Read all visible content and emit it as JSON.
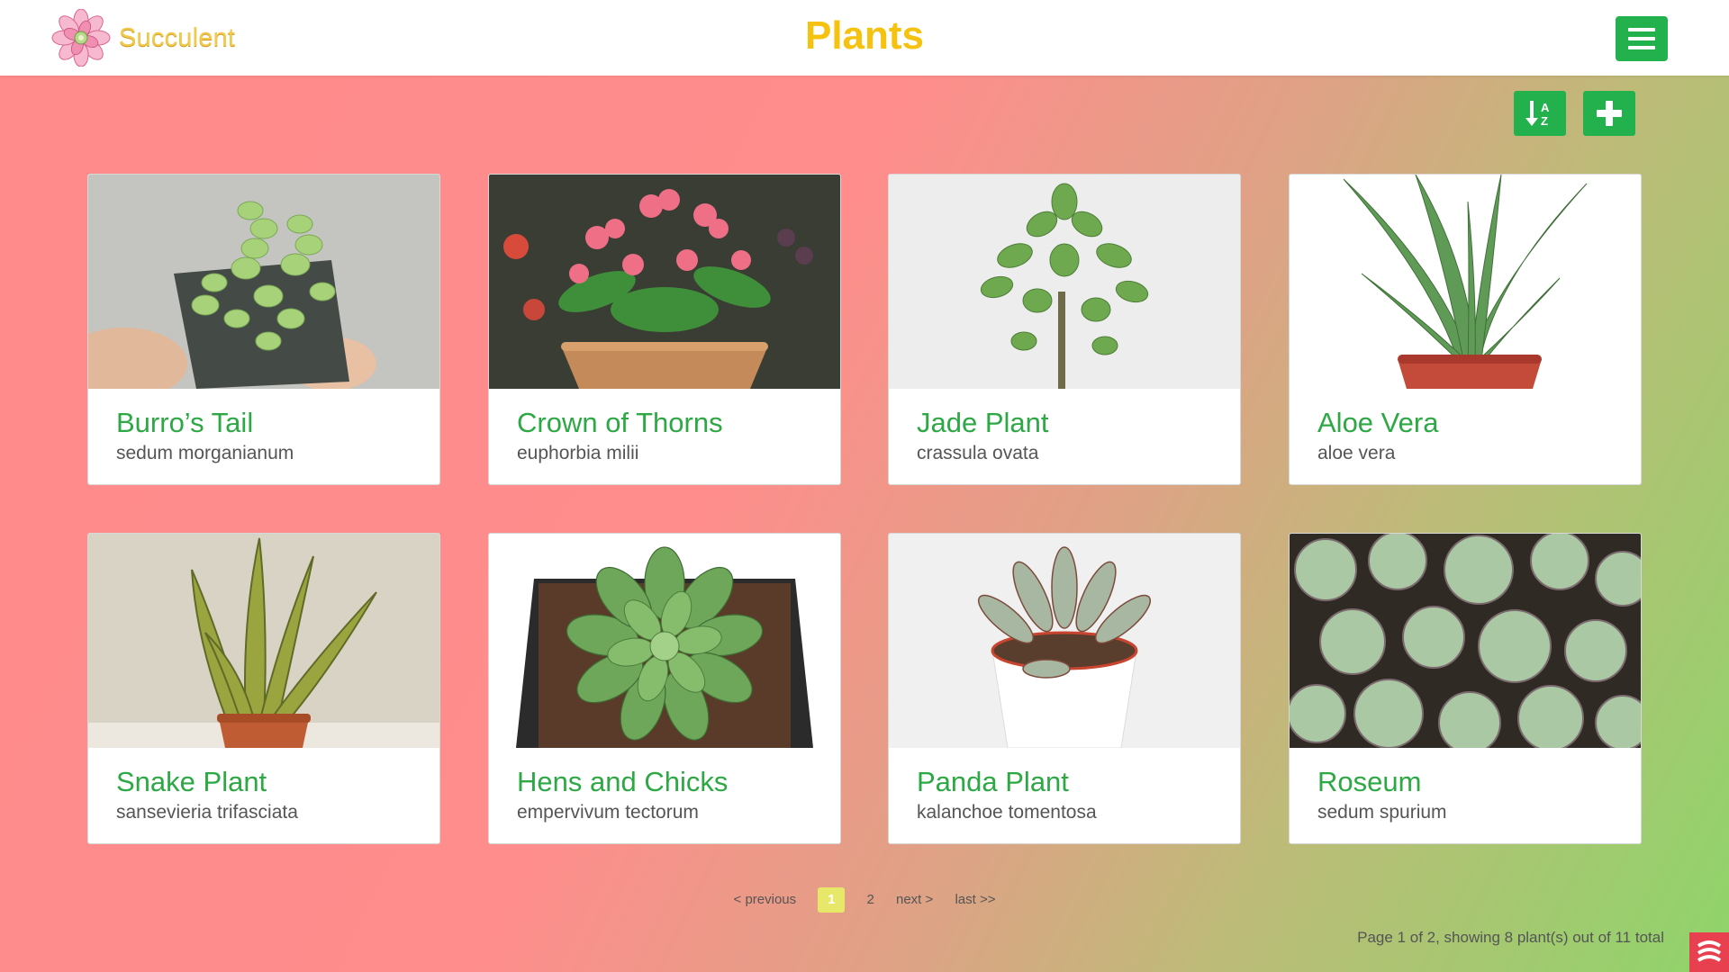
{
  "header": {
    "brand_name": "Succulent",
    "title": "Plants"
  },
  "toolbar": {
    "sort_icon": "sort-alpha-icon",
    "add_icon": "plus-icon",
    "menu_icon": "hamburger-icon"
  },
  "plants": [
    {
      "name": "Burro’s Tail",
      "scientific": "sedum morganianum"
    },
    {
      "name": "Crown of Thorns",
      "scientific": "euphorbia milii"
    },
    {
      "name": "Jade Plant",
      "scientific": "crassula ovata"
    },
    {
      "name": "Aloe Vera",
      "scientific": "aloe vera"
    },
    {
      "name": "Snake Plant",
      "scientific": "sansevieria trifasciata"
    },
    {
      "name": "Hens and Chicks",
      "scientific": "empervivum tectorum"
    },
    {
      "name": "Panda Plant",
      "scientific": "kalanchoe tomentosa"
    },
    {
      "name": "Roseum",
      "scientific": "sedum spurium"
    }
  ],
  "pagination": {
    "previous": "< previous",
    "pages": [
      "1",
      "2"
    ],
    "current": "1",
    "next": "next >",
    "last": "last >>",
    "status": "Page 1 of 2, showing 8 plant(s) out of 11 total"
  },
  "colors": {
    "accent_green": "#22b14c",
    "title_yellow": "#f4c20f",
    "plant_name_green": "#2ca844",
    "gradient_start": "#ff8b8b",
    "gradient_end": "#8fd46a"
  }
}
